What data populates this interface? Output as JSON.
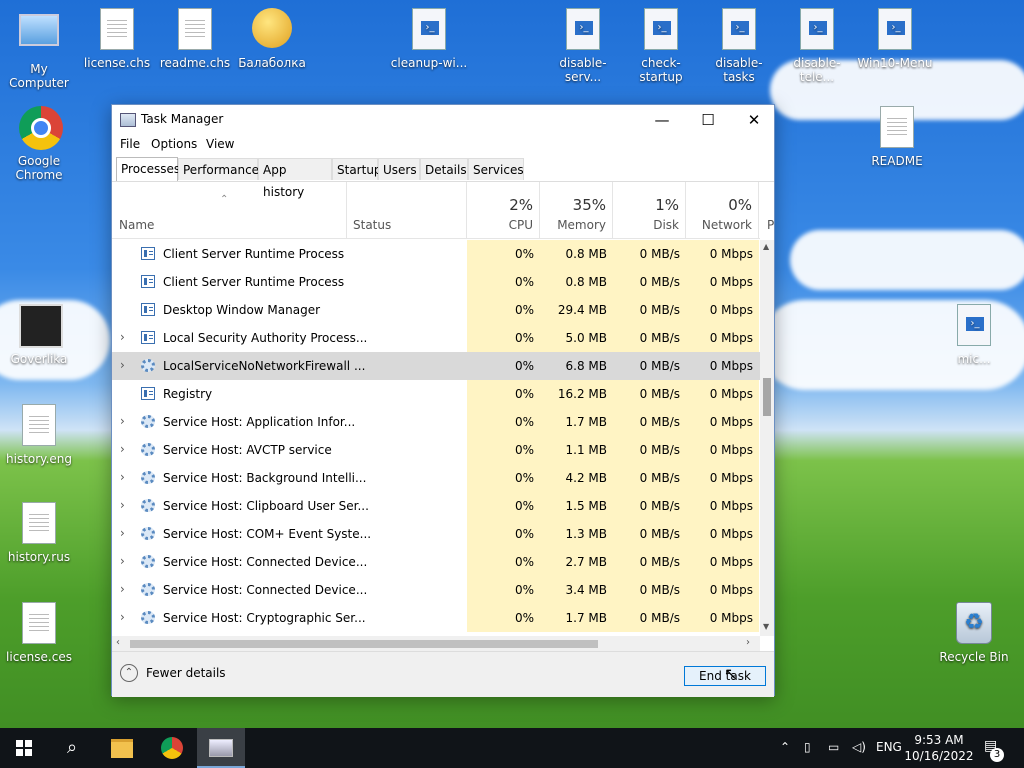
{
  "colors": {
    "accent": "#0078d7",
    "numeric_bg": "#fff4c4",
    "selected_row": "#d9d9d9",
    "taskbar": "#101418"
  },
  "desktop": {
    "icons": [
      {
        "label": "My Computer",
        "icon": "computer-icon"
      },
      {
        "label": "license.chs",
        "icon": "document-icon"
      },
      {
        "label": "readme.chs",
        "icon": "document-icon"
      },
      {
        "label": "Балаболка",
        "icon": "balabolka-icon"
      },
      {
        "label": "cleanup-wi...",
        "icon": "powershell-script-icon"
      },
      {
        "label": "disable-serv...",
        "icon": "powershell-script-icon"
      },
      {
        "label": "check-startup",
        "icon": "powershell-script-icon"
      },
      {
        "label": "disable-tasks",
        "icon": "powershell-script-icon"
      },
      {
        "label": "disable-tele...",
        "icon": "powershell-script-icon"
      },
      {
        "label": "Win10-Menu",
        "icon": "powershell-script-icon"
      },
      {
        "label": "Google Chrome",
        "icon": "chrome-icon"
      },
      {
        "label": "README",
        "icon": "notepad-icon"
      },
      {
        "label": "Goverlika",
        "icon": "goverlika-icon"
      },
      {
        "label": "history.eng",
        "icon": "document-icon"
      },
      {
        "label": "history.rus",
        "icon": "document-icon"
      },
      {
        "label": "license.ces",
        "icon": "document-icon"
      },
      {
        "label": "Recycle Bin",
        "icon": "recycle-bin-icon"
      },
      {
        "label": "mic...",
        "icon": "powershell-script-icon"
      }
    ]
  },
  "window": {
    "title": "Task Manager",
    "controls": {
      "minimize": "—",
      "maximize": "☐",
      "close": "✕"
    },
    "menu": [
      "File",
      "Options",
      "View"
    ],
    "tabs": [
      "Processes",
      "Performance",
      "App history",
      "Startup",
      "Users",
      "Details",
      "Services"
    ],
    "active_tab": "Processes",
    "columns": {
      "name": "Name",
      "status": "Status",
      "cpu": {
        "pct": "2%",
        "label": "CPU"
      },
      "memory": {
        "pct": "35%",
        "label": "Memory"
      },
      "disk": {
        "pct": "1%",
        "label": "Disk"
      },
      "network": {
        "pct": "0%",
        "label": "Network"
      },
      "extra": "P"
    },
    "rows": [
      {
        "name": "Client Server Runtime Process",
        "expandable": false,
        "icon": "box",
        "cpu": "0%",
        "memory": "0.8 MB",
        "disk": "0 MB/s",
        "network": "0 Mbps"
      },
      {
        "name": "Client Server Runtime Process",
        "expandable": false,
        "icon": "box",
        "cpu": "0%",
        "memory": "0.8 MB",
        "disk": "0 MB/s",
        "network": "0 Mbps"
      },
      {
        "name": "Desktop Window Manager",
        "expandable": false,
        "icon": "box",
        "cpu": "0%",
        "memory": "29.4 MB",
        "disk": "0 MB/s",
        "network": "0 Mbps"
      },
      {
        "name": "Local Security Authority Process...",
        "expandable": true,
        "icon": "box",
        "cpu": "0%",
        "memory": "5.0 MB",
        "disk": "0 MB/s",
        "network": "0 Mbps"
      },
      {
        "name": "LocalServiceNoNetworkFirewall ...",
        "expandable": true,
        "icon": "gear",
        "cpu": "0%",
        "memory": "6.8 MB",
        "disk": "0 MB/s",
        "network": "0 Mbps",
        "selected": true
      },
      {
        "name": "Registry",
        "expandable": false,
        "icon": "box",
        "cpu": "0%",
        "memory": "16.2 MB",
        "disk": "0 MB/s",
        "network": "0 Mbps"
      },
      {
        "name": "Service Host: Application Infor...",
        "expandable": true,
        "icon": "gear",
        "cpu": "0%",
        "memory": "1.7 MB",
        "disk": "0 MB/s",
        "network": "0 Mbps"
      },
      {
        "name": "Service Host: AVCTP service",
        "expandable": true,
        "icon": "gear",
        "cpu": "0%",
        "memory": "1.1 MB",
        "disk": "0 MB/s",
        "network": "0 Mbps"
      },
      {
        "name": "Service Host: Background Intelli...",
        "expandable": true,
        "icon": "gear",
        "cpu": "0%",
        "memory": "4.2 MB",
        "disk": "0 MB/s",
        "network": "0 Mbps"
      },
      {
        "name": "Service Host: Clipboard User Ser...",
        "expandable": true,
        "icon": "gear",
        "cpu": "0%",
        "memory": "1.5 MB",
        "disk": "0 MB/s",
        "network": "0 Mbps"
      },
      {
        "name": "Service Host: COM+ Event Syste...",
        "expandable": true,
        "icon": "gear",
        "cpu": "0%",
        "memory": "1.3 MB",
        "disk": "0 MB/s",
        "network": "0 Mbps"
      },
      {
        "name": "Service Host: Connected Device...",
        "expandable": true,
        "icon": "gear",
        "cpu": "0%",
        "memory": "2.7 MB",
        "disk": "0 MB/s",
        "network": "0 Mbps"
      },
      {
        "name": "Service Host: Connected Device...",
        "expandable": true,
        "icon": "gear",
        "cpu": "0%",
        "memory": "3.4 MB",
        "disk": "0 MB/s",
        "network": "0 Mbps"
      },
      {
        "name": "Service Host: Cryptographic Ser...",
        "expandable": true,
        "icon": "gear",
        "cpu": "0%",
        "memory": "1.7 MB",
        "disk": "0 MB/s",
        "network": "0 Mbps"
      }
    ],
    "footer": {
      "fewer_details": "Fewer details",
      "end_task": "End task"
    }
  },
  "taskbar": {
    "language": "ENG",
    "time": "9:53 AM",
    "date": "10/16/2022",
    "notification_count": "3"
  }
}
